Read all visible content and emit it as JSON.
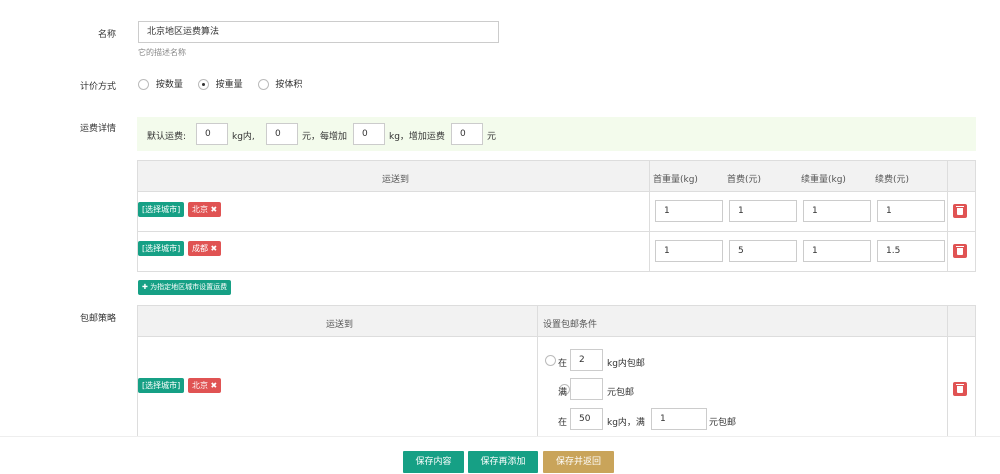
{
  "name_field": {
    "label": "名称",
    "value": "北京地区运费算法",
    "hint": "它的描述名称"
  },
  "pricing_mode": {
    "label": "计价方式",
    "options": [
      "按数量",
      "按重量",
      "按体积"
    ],
    "selected": "按重量"
  },
  "freight": {
    "label": "运费详情",
    "default_prefix": "默认运费:",
    "default_weight": "0",
    "unit_kg_within": "kg内,",
    "default_fee": "0",
    "unit_yuan_each": "元，每增加",
    "add_weight": "0",
    "unit_kg_add": "kg，增加运费",
    "add_fee": "0",
    "unit_yuan": "元",
    "table_headers": [
      "运送到",
      "首重量(kg)",
      "首费(元)",
      "续重量(kg)",
      "续费(元)"
    ],
    "rows": [
      {
        "select_city": "[选择城市]",
        "city": "北京",
        "first_weight": "1",
        "first_fee": "1",
        "cont_weight": "1",
        "cont_fee": "1"
      },
      {
        "select_city": "[选择城市]",
        "city": "成都",
        "first_weight": "1",
        "first_fee": "5",
        "cont_weight": "1",
        "cont_fee": "1.5"
      }
    ],
    "add_region_btn": "✚ 为指定地区城市设置运费"
  },
  "free_shipping": {
    "label": "包邮策略",
    "table_headers": [
      "运送到",
      "设置包邮条件"
    ],
    "row": {
      "select_city": "[选择城市]",
      "city": "北京",
      "cond1_prefix": "在",
      "cond1_value": "2",
      "cond1_suffix": "kg内包邮",
      "cond2_prefix": "满",
      "cond2_value": "",
      "cond2_suffix": "元包邮",
      "cond3_prefix": "在",
      "cond3_value1": "50",
      "cond3_mid": "kg内，满",
      "cond3_value2": "1",
      "cond3_suffix": "元包邮"
    }
  },
  "footer": {
    "save": "保存内容",
    "save_add": "保存再添加",
    "save_return": "保存并返回"
  },
  "colors": {
    "teal": "#16a085",
    "red": "#e05353",
    "gold": "#c9a45a",
    "header_bg": "#f2f2f2",
    "green_bg": "#f3fbec"
  }
}
